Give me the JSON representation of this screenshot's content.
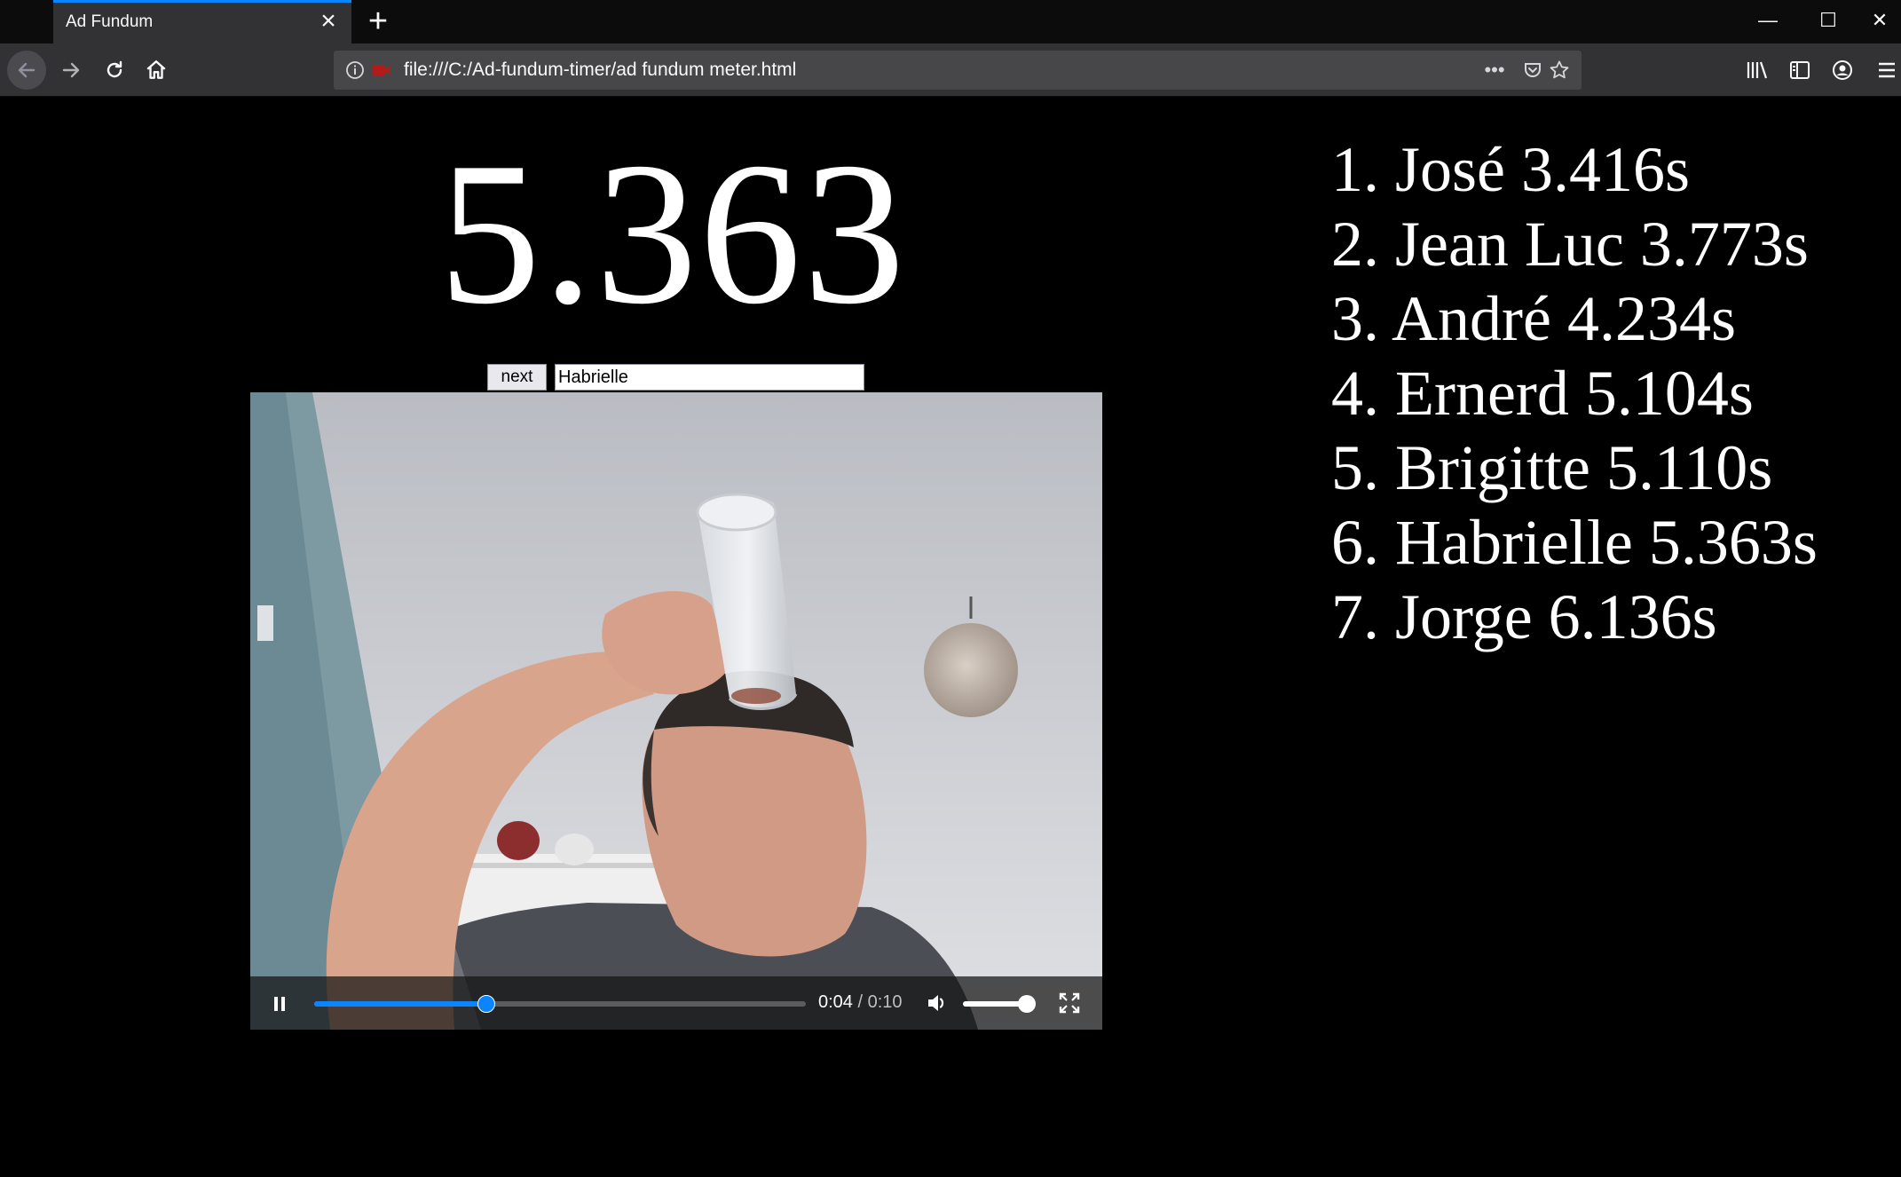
{
  "browser": {
    "tab_title": "Ad Fundum",
    "url": "file:///C:/Ad-fundum-timer/ad fundum meter.html",
    "icons": [
      "back-arrow-icon",
      "forward-arrow-icon",
      "reload-icon",
      "home-icon",
      "info-icon",
      "tracking-icon",
      "more-dots-icon",
      "pocket-icon",
      "star-icon",
      "library-icon",
      "sidebar-icon",
      "account-icon",
      "menu-icon",
      "minimize-icon",
      "maximize-icon",
      "close-icon",
      "plus-icon"
    ]
  },
  "timer": {
    "value": "5.363"
  },
  "controls": {
    "next_label": "next",
    "name_value": "Habrielle"
  },
  "video": {
    "current_time": "0:04",
    "separator": "/",
    "duration": "0:10",
    "progress": 0.35,
    "volume": 0.9,
    "accent_color": "#0a84ff"
  },
  "ranking": [
    "1. José 3.416s",
    "2. Jean Luc 3.773s",
    "3. André 4.234s",
    "4. Ernerd 5.104s",
    "5. Brigitte 5.110s",
    "6. Habrielle 5.363s",
    "7. Jorge 6.136s"
  ]
}
